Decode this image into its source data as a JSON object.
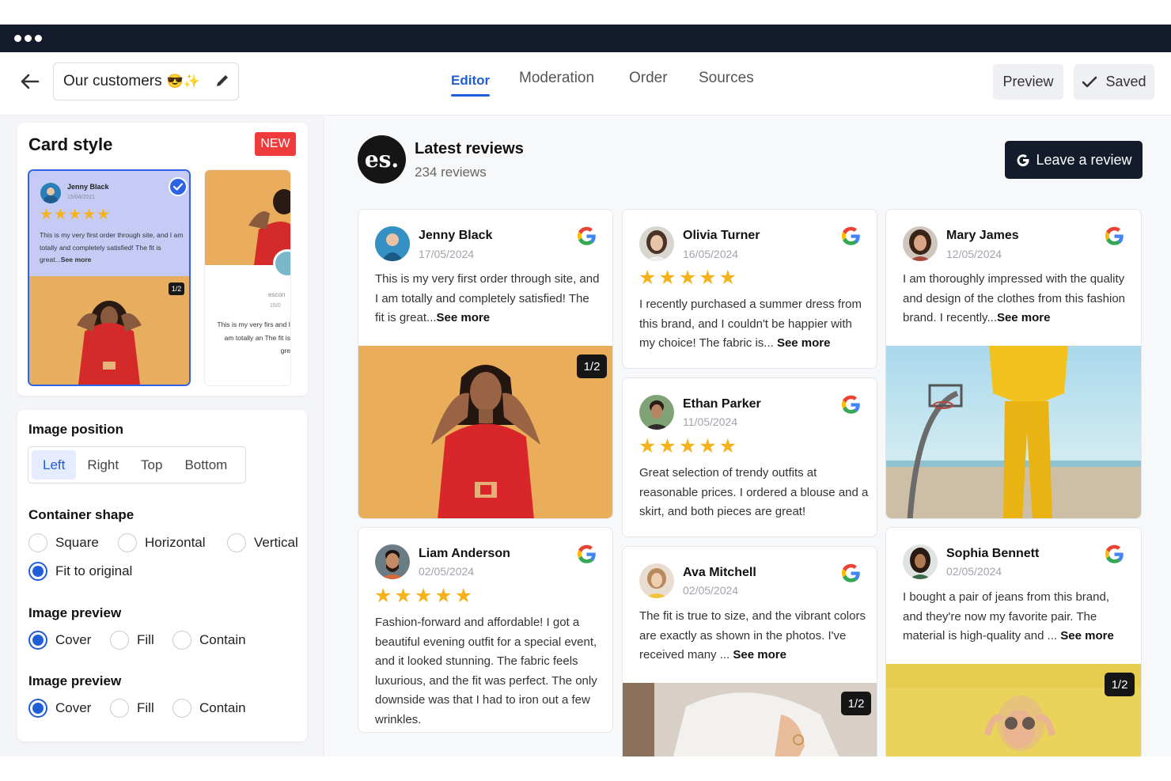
{
  "header": {
    "title": "Our customers",
    "title_emoji": "😎✨",
    "tabs": [
      "Editor",
      "Moderation",
      "Order",
      "Sources"
    ],
    "preview_label": "Preview",
    "saved_label": "Saved"
  },
  "card_style": {
    "title": "Card style",
    "badge": "NEW",
    "mini": {
      "name": "Jenny Black",
      "date": "15/04/2021",
      "stars": "★★★★★",
      "text": "This is my very first order through site, and I am totally and completely satisfied! The fit is great...",
      "see_more": "See more",
      "pager": "1/2",
      "alt_brand": "escon",
      "alt_date": "15/0",
      "alt_text": "This is my very firs and I am totally an The fit is gre"
    }
  },
  "image_position": {
    "title": "Image position",
    "options": [
      "Left",
      "Right",
      "Top",
      "Bottom"
    ]
  },
  "container_shape": {
    "title": "Container shape",
    "options": [
      "Square",
      "Horizontal",
      "Vertical",
      "Fit to original"
    ]
  },
  "image_preview_1": {
    "title": "Image preview",
    "options": [
      "Cover",
      "Fill",
      "Contain"
    ]
  },
  "image_preview_2": {
    "title": "Image preview",
    "options": [
      "Cover",
      "Fill",
      "Contain"
    ]
  },
  "widget": {
    "logo_text": "es.",
    "title": "Latest reviews",
    "count": "234 reviews",
    "leave_label": "Leave a review"
  },
  "reviews": [
    {
      "name": "Jenny Black",
      "date": "17/05/2024",
      "stars": "",
      "text": "This is my very first order through site, and I am totally and completely satisfied! The fit is great...",
      "see_more": "See more",
      "pager": "1/2"
    },
    {
      "name": "Olivia Turner",
      "date": "16/05/2024",
      "stars": "★★★★★",
      "text": "I recently purchased a summer dress from this brand, and I couldn't be happier with my choice! The fabric is... ",
      "see_more": "See more"
    },
    {
      "name": "Mary James",
      "date": "12/05/2024",
      "stars": "",
      "text": "I am thoroughly impressed with the quality and design of the clothes from this fashion brand. I recently...",
      "see_more": "See more"
    },
    {
      "name": "Ethan Parker",
      "date": "11/05/2024",
      "stars": "★★★★★",
      "text": "Great selection of trendy outfits at reasonable prices. I ordered a blouse and a skirt, and both pieces are great!"
    },
    {
      "name": "Liam Anderson",
      "date": "02/05/2024",
      "stars": "★★★★★",
      "text": "Fashion-forward and affordable! I got a beautiful evening outfit for a special event, and it looked stunning. The fabric feels luxurious, and the fit was perfect. The only downside was that I had to iron out a few wrinkles."
    },
    {
      "name": "Ava Mitchell",
      "date": "02/05/2024",
      "stars": "",
      "text": "The fit is true to size, and the vibrant colors are exactly as shown in the photos. I've received many ... ",
      "see_more": "See more",
      "pager": "1/2"
    },
    {
      "name": "Sophia Bennett",
      "date": "02/05/2024",
      "stars": "",
      "text": "I bought a pair of jeans from this brand, and they're now my favorite pair. The material is high-quality and ... ",
      "see_more": "See more",
      "pager": "1/2"
    }
  ],
  "colors": {
    "accent": "#1f5ed8",
    "star": "#f6b21b",
    "badge": "#ee3b3b",
    "chrome": "#121a2b"
  }
}
